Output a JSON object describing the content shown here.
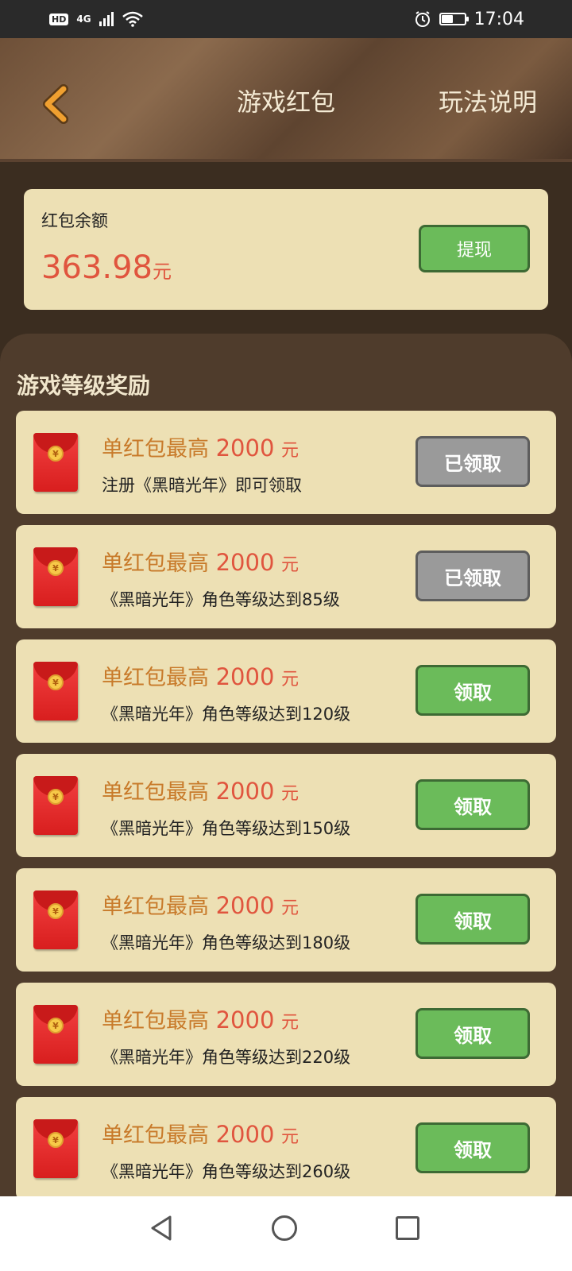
{
  "status_bar": {
    "badge": "HD",
    "network": "4G",
    "time": "17:04",
    "battery_level": 0.5
  },
  "header": {
    "title": "游戏红包",
    "help_label": "玩法说明"
  },
  "balance": {
    "label": "红包余额",
    "amount": "363.98",
    "unit": "元",
    "withdraw_label": "提现"
  },
  "section": {
    "title": "游戏等级奖励"
  },
  "rewards": [
    {
      "prefix": "单红包最高",
      "amount": "2000",
      "unit": "元",
      "desc": "注册《黑暗光年》即可领取",
      "button": "已领取",
      "claimed": true
    },
    {
      "prefix": "单红包最高",
      "amount": "2000",
      "unit": "元",
      "desc": "《黑暗光年》角色等级达到85级",
      "button": "已领取",
      "claimed": true
    },
    {
      "prefix": "单红包最高",
      "amount": "2000",
      "unit": "元",
      "desc": "《黑暗光年》角色等级达到120级",
      "button": "领取",
      "claimed": false
    },
    {
      "prefix": "单红包最高",
      "amount": "2000",
      "unit": "元",
      "desc": "《黑暗光年》角色等级达到150级",
      "button": "领取",
      "claimed": false
    },
    {
      "prefix": "单红包最高",
      "amount": "2000",
      "unit": "元",
      "desc": "《黑暗光年》角色等级达到180级",
      "button": "领取",
      "claimed": false
    },
    {
      "prefix": "单红包最高",
      "amount": "2000",
      "unit": "元",
      "desc": "《黑暗光年》角色等级达到220级",
      "button": "领取",
      "claimed": false
    },
    {
      "prefix": "单红包最高",
      "amount": "2000",
      "unit": "元",
      "desc": "《黑暗光年》角色等级达到260级",
      "button": "领取",
      "claimed": false
    }
  ],
  "icons": {
    "back": "chevron-left-icon",
    "envelope": "red-envelope-icon",
    "nav_back": "triangle-back-icon",
    "nav_home": "circle-home-icon",
    "nav_recent": "square-recent-icon"
  },
  "colors": {
    "accent_red": "#e0553e",
    "button_green": "#6bbb5a",
    "button_gray": "#9a9a9a",
    "card_bg": "#ede0b4",
    "panel_bg": "#4f3c2c"
  }
}
